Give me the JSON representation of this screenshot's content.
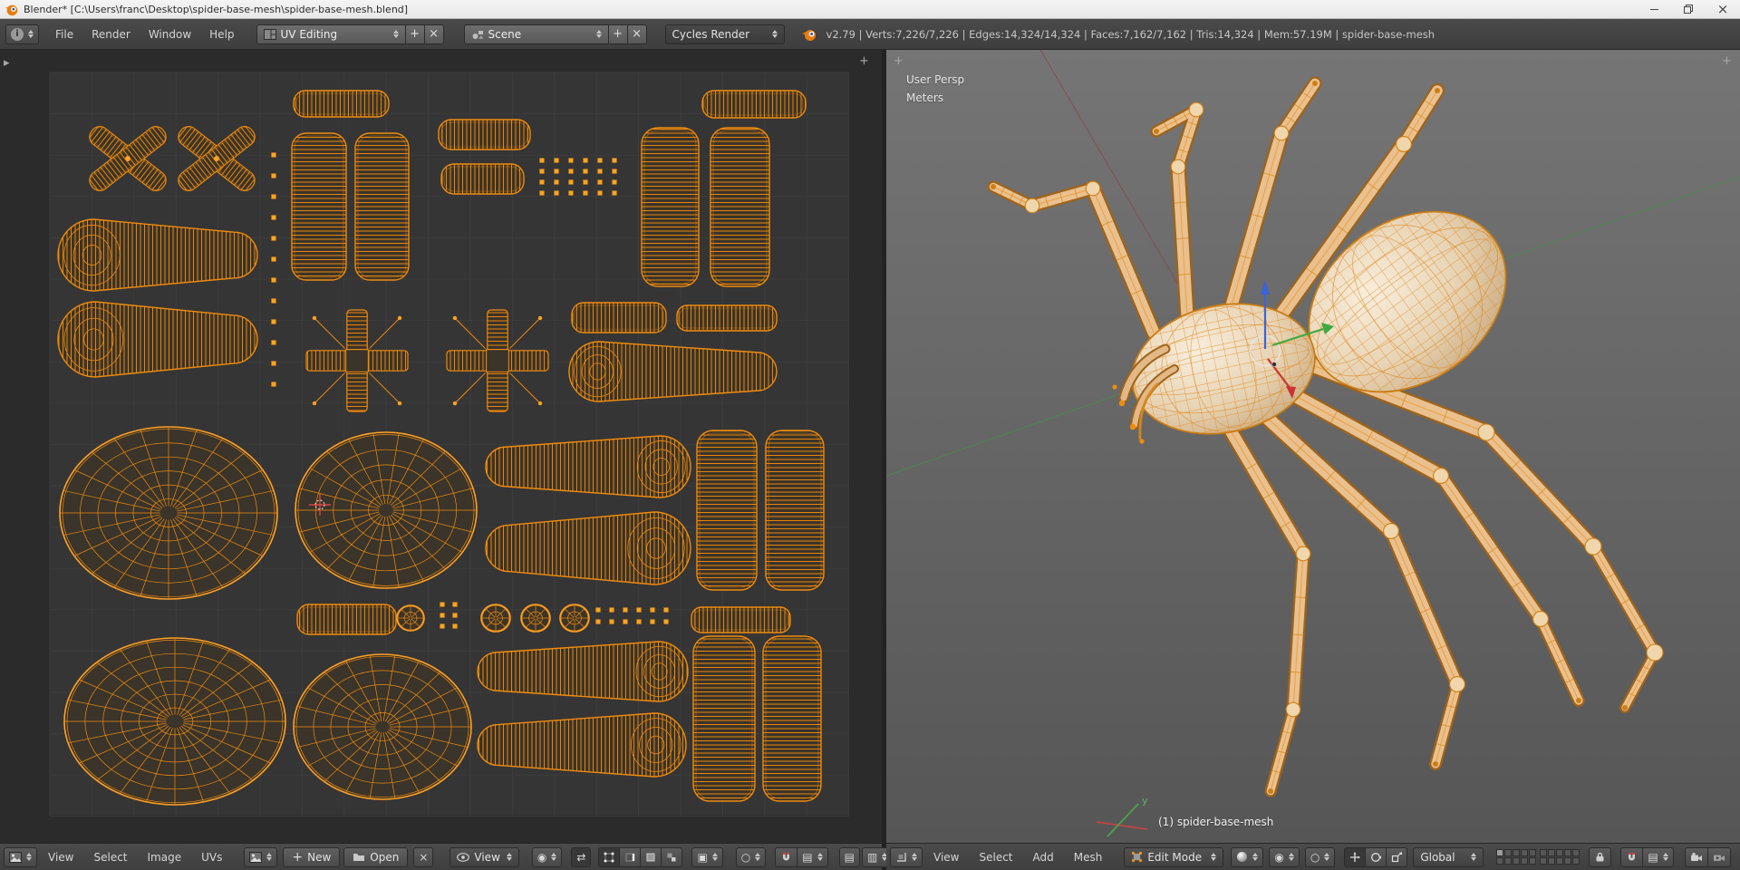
{
  "window": {
    "title": "Blender* [C:\\Users\\franc\\Desktop\\spider-base-mesh\\spider-base-mesh.blend]"
  },
  "header": {
    "menus": [
      "File",
      "Render",
      "Window",
      "Help"
    ],
    "layout": "UV Editing",
    "scene": "Scene",
    "engine": "Cycles Render",
    "stats": "v2.79 | Verts:7,226/7,226 | Edges:14,324/14,324 | Faces:7,162/7,162 | Tris:14,324 | Mem:57.19M | spider-base-mesh"
  },
  "uv_footer": {
    "menus": [
      "View",
      "Select",
      "Image",
      "UVs"
    ],
    "new_label": "New",
    "open_label": "Open",
    "mode": "View"
  },
  "v3d_footer": {
    "menus": [
      "View",
      "Select",
      "Add",
      "Mesh"
    ],
    "mode": "Edit Mode",
    "orientation": "Global"
  },
  "viewport": {
    "view_name": "User Persp",
    "units": "Meters",
    "object_info": "(1) spider-base-mesh",
    "axis_y_label": "y"
  },
  "icons": {
    "pivot": "◉",
    "sync": "⇄",
    "proportional": "○",
    "unlink": "×",
    "sticky": "▣",
    "draw_type": "▤",
    "scopes": "▥",
    "plus": "+",
    "close_small": "×",
    "window_close": "×"
  },
  "colors": {
    "uv_wire": "#ef8b0e",
    "selection_orange": "#ff9a1e",
    "body_tan": "#e9d6ba"
  }
}
